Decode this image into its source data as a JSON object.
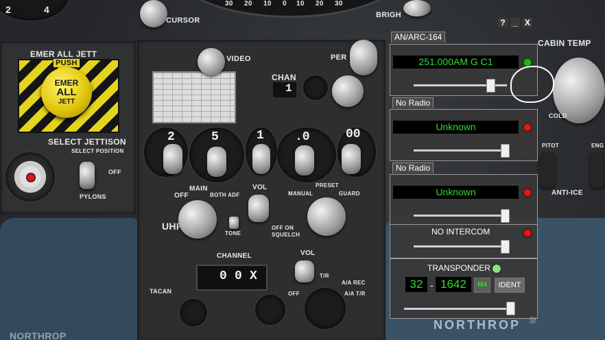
{
  "cockpit": {
    "labels": {
      "emer_all_jett": "EMER ALL JETT",
      "push": "PUSH",
      "emer": "EMER",
      "all": "ALL",
      "jett": "JETT",
      "select_jettison": "SELECT JETTISON",
      "select_position": "SELECT POSITION",
      "off": "OFF",
      "pylons": "PYLONS",
      "cursor": "CURSOR",
      "video": "VIDEO",
      "chan": "CHAN",
      "chan_value": "1",
      "per": "PER",
      "brigh": "BRIGH",
      "cabin_temp": "CABIN TEMP",
      "cold": "COLD",
      "pitot": "PITOT",
      "engine": "ENG",
      "anti_ice": "ANTI-ICE",
      "uhf": "UHF",
      "main": "MAIN",
      "both_adf": "BOTH ADF",
      "off_uhf": "OFF",
      "vol": "VOL",
      "manual": "MANUAL",
      "preset": "PRESET",
      "guard": "GUARD",
      "tone": "TONE",
      "squelch": "SQUELCH",
      "off_on": "OFF ON",
      "channel": "CHANNEL",
      "tacan": "TACAN",
      "tacan_vol": "VOL",
      "tr": "T/R",
      "aa_rec": "A/A REC",
      "aa_tr": "A/A T/R",
      "off_tacan": "OFF",
      "northrop": "NORTHROP"
    },
    "freq_digits": [
      "2",
      "5",
      "1",
      ".0",
      "00"
    ],
    "tacan_digits": [
      "0",
      "0",
      "X"
    ],
    "gauge_numbers": [
      "30",
      "20",
      "10",
      "0",
      "10",
      "20",
      "30"
    ],
    "left_gauge_numbers": [
      "2",
      "4"
    ]
  },
  "overlay": {
    "controls": {
      "help": "?",
      "minimize": "_",
      "close": "X"
    },
    "radios": [
      {
        "name": "AN/ARC-164",
        "frequency": "251.000AM G C1",
        "status_color": "#1bb81b",
        "volume": 0.82
      },
      {
        "name": "No Radio",
        "frequency": "Unknown",
        "status_color": "#e01818",
        "volume": 0.98
      },
      {
        "name": "No Radio",
        "frequency": "Unknown",
        "status_color": "#e01818",
        "volume": 0.98
      }
    ],
    "intercom": {
      "title": "NO INTERCOM",
      "status_color": "#e01818",
      "volume": 0.98
    },
    "transponder": {
      "title": "TRANSPONDER",
      "status_color": "#8fe07f",
      "mode1": "32",
      "separator": "-",
      "mode3": "1642",
      "m4_label": "M4",
      "ident_label": "IDENT",
      "volume": 0.98
    }
  }
}
